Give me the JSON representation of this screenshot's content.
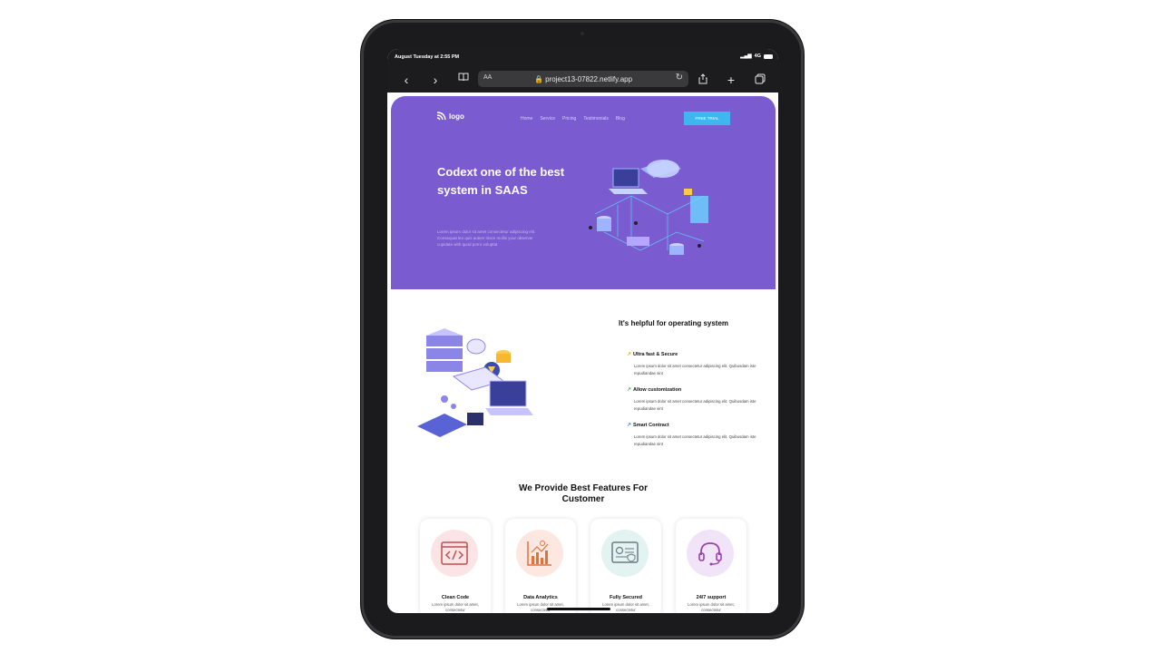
{
  "status": {
    "time": "August Tuesday at 2:55 PM",
    "network": "4G"
  },
  "browser": {
    "text_size": "AA",
    "url": "project13-07822.netlify.app"
  },
  "site": {
    "logo": "logo",
    "nav": [
      "Home",
      "Service",
      "Pricing",
      "Testimonials",
      "Blog"
    ],
    "cta": "FREE TRIAL",
    "hero": {
      "title": "Codext one of the best system in SAAS",
      "description": "Lorem ipsum dolor sit amet consectetur adipiscing elit. Consequat leo quis autem trisce mollis your observer cupidate with quod porro voluptat"
    },
    "helpful": {
      "title": "It's helpful for operating system",
      "items": [
        {
          "title": "Ultra fast & Secure",
          "description": "Lorem ipsum dolor sit amet consectetur adipiscing elit. Quibusdam iste repudiandae sint",
          "color": "#f5a623"
        },
        {
          "title": "Allow customization",
          "description": "Lorem ipsum dolor sit amet consectetur adipiscing elit. Quibusdam iste repudiandae sint",
          "color": "#4caf50"
        },
        {
          "title": "Smart Contract",
          "description": "Lorem ipsum dolor sit amet consectetur adipiscing elit. Quibusdam iste repudiandae sint",
          "color": "#3b82f6"
        }
      ]
    },
    "features": {
      "title": "We Provide Best Features For Customer",
      "cards": [
        {
          "title": "Clean Code",
          "text": "Lorem ipsum dolor sit amet, consectetur",
          "icon": "code-window-icon",
          "bg": "#fbe4e6"
        },
        {
          "title": "Data Analytics",
          "text": "Lorem ipsum dolor sit amet, consectetur",
          "icon": "chart-icon",
          "bg": "#fde7e1"
        },
        {
          "title": "Fully Secured",
          "text": "Lorem ipsum dolor sit amet, consectetur",
          "icon": "secure-id-icon",
          "bg": "#e3f3f1"
        },
        {
          "title": "24/7 support",
          "text": "Lorem ipsum dolor sit amet, consectetur",
          "icon": "headset-icon",
          "bg": "#f1e4f8"
        }
      ]
    }
  },
  "colors": {
    "hero_bg": "#7a5bd0",
    "cta_bg": "#3eb7f0"
  }
}
